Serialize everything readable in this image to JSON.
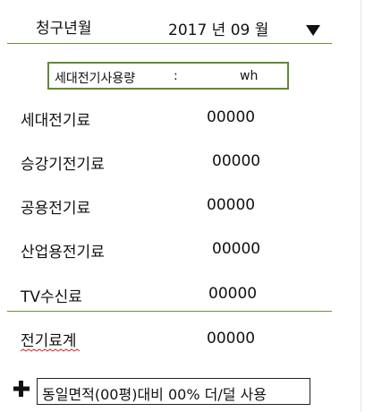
{
  "header": {
    "billing_month_label": "청구년월",
    "billing_month_value": "2017 년 09 월",
    "dropdown_icon": "triangle-down-icon"
  },
  "usage": {
    "label": "세대전기사용량",
    "separator": ":",
    "unit": "wh"
  },
  "fees": [
    {
      "label": "세대전기료",
      "value": "00000"
    },
    {
      "label": "승강기전기료",
      "value": "00000"
    },
    {
      "label": "공용전기료",
      "value": "00000"
    },
    {
      "label": "산업용전기료",
      "value": "00000"
    },
    {
      "label": "TV수신료",
      "value": "00000"
    }
  ],
  "total": {
    "label": "전기료계",
    "value": "00000"
  },
  "comparison": {
    "icon": "plus-icon",
    "text": "동일면적(00평)대비 00% 더/덜 사용"
  },
  "colors": {
    "divider": "#6b8f3e",
    "box_border": "#5f8a35",
    "spellcheck": "#d9302c"
  }
}
